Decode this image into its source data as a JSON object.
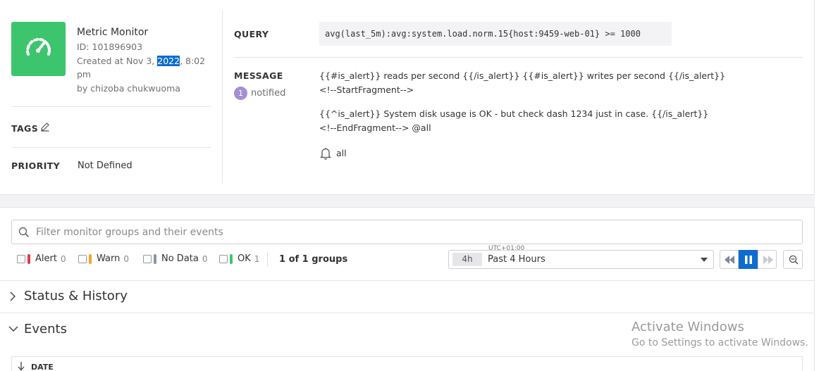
{
  "monitor": {
    "title": "Metric Monitor",
    "id": "ID: 101896903",
    "created_prefix": "Created at Nov 3, ",
    "created_year": "2022",
    "created_suffix": ", 8:02",
    "created_line2": "pm",
    "by": "by chizoba chukwuoma",
    "icon": "speedometer-icon",
    "color": "#3cc56d"
  },
  "tags": {
    "label": "TAGS",
    "edit_icon": "pencil-icon"
  },
  "priority": {
    "label": "PRIORITY",
    "value": "Not Defined"
  },
  "query": {
    "label": "QUERY",
    "value": "avg(last_5m):avg:system.load.norm.15{host:9459-web-01} >= 1000"
  },
  "message": {
    "label": "MESSAGE",
    "notified_count": "1",
    "notified_label": "notified",
    "lines": [
      "{{#is_alert}} reads per second {{/is_alert}} {{#is_alert}} writes per second {{/is_alert}}",
      "<!--StartFragment-->",
      "{{^is_alert}} System disk usage is OK - but check dash 1234 just in case. {{/is_alert}}",
      "<!--EndFragment--> @all"
    ],
    "recipient": "all"
  },
  "filter": {
    "placeholder": "Filter monitor groups and their events"
  },
  "statuses": [
    {
      "label": "Alert",
      "count": "0",
      "color": "#e4384b"
    },
    {
      "label": "Warn",
      "count": "0",
      "color": "#f5a623"
    },
    {
      "label": "No Data",
      "count": "0",
      "color": "#8a93a8"
    },
    {
      "label": "OK",
      "count": "1",
      "color": "#3cc56d"
    }
  ],
  "groups": "1 of 1 groups",
  "timeframe": {
    "timezone": "UTC+01:00",
    "short": "4h",
    "label": "Past 4 Hours"
  },
  "sections": {
    "status_history": "Status & History",
    "events": "Events"
  },
  "events_table": {
    "date_header": "DATE"
  },
  "watermark": {
    "line1": "Activate Windows",
    "line2": "Go to Settings to activate Windows."
  }
}
